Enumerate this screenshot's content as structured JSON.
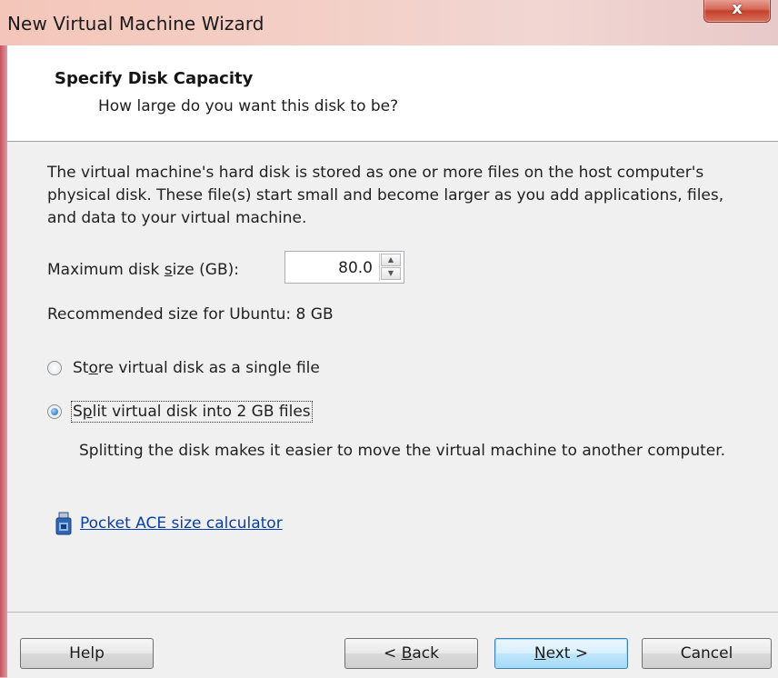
{
  "window": {
    "title": "New Virtual Machine Wizard",
    "close_glyph": "x"
  },
  "header": {
    "title": "Specify Disk Capacity",
    "subtitle": "How large do you want this disk to be?"
  },
  "content": {
    "description": "The virtual machine's hard disk is stored as one or more files on the host computer's physical disk. These file(s) start small and become larger as you add applications, files, and data to your virtual machine.",
    "max_size_label_pre": "Maximum disk ",
    "max_size_label_key": "s",
    "max_size_label_post": "ize (GB):",
    "max_size_value": "80.0",
    "recommended": "Recommended size for Ubuntu: 8 GB",
    "radio_single": {
      "pre": "St",
      "key": "o",
      "post": "re virtual disk as a single file",
      "checked": false
    },
    "radio_split": {
      "pre": "S",
      "key": "p",
      "post": "lit virtual disk into 2 GB files",
      "checked": true
    },
    "split_note": "Splitting the disk makes it easier to move the virtual machine to another computer.",
    "calculator_link": "Pocket ACE size calculator"
  },
  "footer": {
    "help": "Help",
    "back_pre": "< ",
    "back_key": "B",
    "back_post": "ack",
    "next_key": "N",
    "next_post": "ext >",
    "cancel": "Cancel"
  },
  "icons": {
    "close": "close-icon",
    "spin_up": "spin-up-icon",
    "spin_down": "spin-down-icon",
    "calculator": "usb-drive-icon"
  }
}
